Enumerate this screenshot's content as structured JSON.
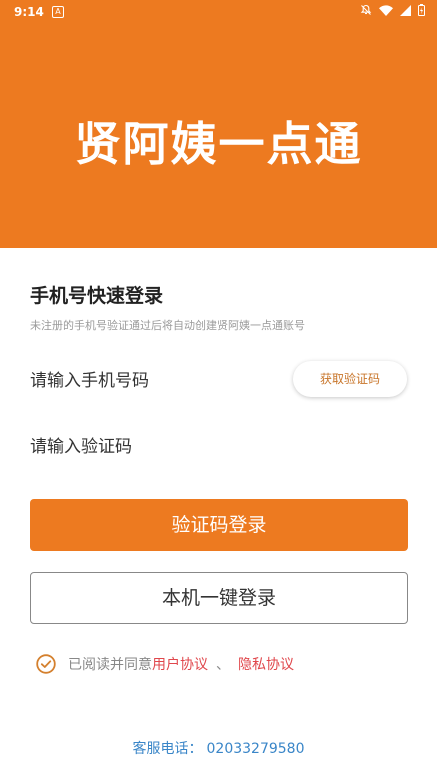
{
  "status_bar": {
    "time": "9:14",
    "notification_letter": "A",
    "icons": [
      "notifications-off-icon",
      "wifi-icon",
      "signal-icon",
      "battery-icon"
    ]
  },
  "header": {
    "app_title": "贤阿姨一点通",
    "background_color": "#ED7A20"
  },
  "login": {
    "title": "手机号快速登录",
    "subtitle": "未注册的手机号验证通过后将自动创建贤阿姨一点通账号",
    "phone_placeholder": "请输入手机号码",
    "get_code_label": "获取验证码",
    "code_placeholder": "请输入验证码",
    "code_login_label": "验证码登录",
    "one_click_login_label": "本机一键登录"
  },
  "agreement": {
    "checked": true,
    "prefix": "已阅读并同意",
    "user_agreement": "用户协议",
    "separator": "、",
    "privacy_policy": "隐私协议",
    "link_color": "#E0474C"
  },
  "footer": {
    "hotline_label": "客服电话：",
    "hotline_number": "02033279580"
  },
  "colors": {
    "accent": "#ED7A20",
    "check": "#D4802E",
    "hotline": "#3A86C8"
  }
}
